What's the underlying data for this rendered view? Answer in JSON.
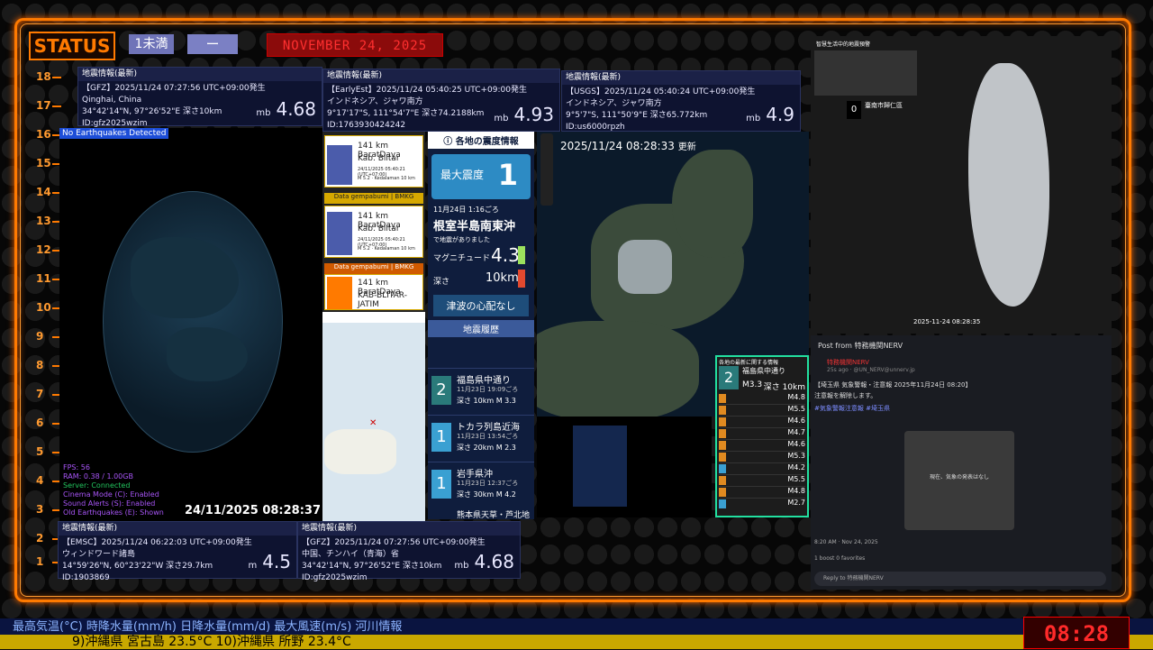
{
  "status": {
    "label": "STATUS",
    "badge1": "1未満",
    "badge2": "ー",
    "date": "NOVEMBER 24, 2025"
  },
  "ruler": [
    "18",
    "17",
    "16",
    "15",
    "14",
    "13",
    "12",
    "11",
    "10",
    "9",
    "8",
    "7",
    "6",
    "5",
    "4",
    "3",
    "2",
    "1"
  ],
  "cards": [
    {
      "hdr": "地震情報(最新)",
      "l1": "【GFZ】2025/11/24  07:27:56  UTC+09:00発生",
      "l2": "Qinghai, China",
      "l3": "34°42'14\"N, 97°26'52\"E  深さ10km",
      "l4": "ID:gfz2025wzim",
      "mb": "mb",
      "mag": "4.68"
    },
    {
      "hdr": "地震情報(最新)",
      "l1": "【EarlyEst】2025/11/24  05:40:25  UTC+09:00発生",
      "l2": "インドネシア、ジャワ南方",
      "l3": "9°17'17\"S, 111°54'7\"E  深さ74.2188km",
      "l4": "ID:1763930424242",
      "mb": "mb",
      "mag": "4.93"
    },
    {
      "hdr": "地震情報(最新)",
      "l1": "【USGS】2025/11/24  05:40:24  UTC+09:00発生",
      "l2": "インドネシア、ジャワ南方",
      "l3": "9°5'7\"S, 111°50'9\"E  深さ65.772km",
      "l4": "ID:us6000rpzh",
      "mb": "mb",
      "mag": "4.9"
    },
    {
      "hdr": "地震情報(最新)",
      "l1": "【EMSC】2025/11/24  06:22:03  UTC+09:00発生",
      "l2": "ウィンドワード諸島",
      "l3": "14°59'26\"N, 60°23'22\"W  深さ29.7km",
      "l4": "ID:1903869",
      "mb": "m",
      "mag": "4.5"
    },
    {
      "hdr": "地震情報(最新)",
      "l1": "【GFZ】2025/11/24  07:27:56  UTC+09:00発生",
      "l2": "中国、チンハイ（青海）省",
      "l3": "34°42'14\"N, 97°26'52\"E  深さ10km",
      "l4": "ID:gfz2025wzim",
      "mb": "mb",
      "mag": "4.68"
    }
  ],
  "globe": {
    "notice": "No Earthquakes Detected",
    "timestamp": "24/11/2025 08:28:37",
    "debug": [
      "FPS: 56",
      "RAM: 0.38 / 1.00GB",
      "Server: Connected",
      "Cinema Mode (C): Enabled",
      "Sound Alerts (S): Enabled",
      "Old Earthquakes (E): Shown"
    ]
  },
  "indo": [
    {
      "head": "Data gempabumi | BMKG",
      "dist": "141 km BaratDaya",
      "place": "Kab. Blitar",
      "date": "24/11/2025 05:40:21 (UTC+07:00)",
      "mag": "M 5.2 · Kedalaman 10 km"
    },
    {
      "head": "Data gempabumi | BMKG",
      "dist": "141 km BaratDaya",
      "place": "Kab. Blitar",
      "date": "24/11/2025 05:40:21 (UTC+07:00)",
      "mag": "M 5.2 · Kedalaman 10 km"
    },
    {
      "head": "Data gempabumi | BMKG",
      "dist": "141 km BaratDaya",
      "place": "KAB-BLITAR-JATIM",
      "date": "",
      "mag": ""
    }
  ],
  "jp": {
    "title": "ⓘ 各地の震度情報",
    "maxlabel": "最大震度",
    "maxval": "1",
    "when": "11月24日 1:16ごろ",
    "place": "根室半島南東沖",
    "sub": "で地震がありました",
    "maglabel": "マグニチュード",
    "mag": "4.3",
    "depthlabel": "深さ",
    "depth": "10km",
    "tsunami": "津波の心配なし",
    "histtitle": "地震履歴",
    "history": [
      {
        "n": "2",
        "t": "福島県中通り",
        "s": "11月23日 19:09ごろ",
        "m": "深さ 10km  M 3.3"
      },
      {
        "n": "1",
        "t": "トカラ列島近海",
        "s": "11月23日 13:54ごろ",
        "m": "深さ 20km  M 2.3"
      },
      {
        "n": "1",
        "t": "岩手県沖",
        "s": "11月23日 12:37ごろ",
        "m": "深さ 30km  M 4.2"
      }
    ],
    "last": "熊本県天草・芦北地方"
  },
  "map": {
    "timestamp": "2025/11/24  08:28:33",
    "upd": "更新"
  },
  "recent": {
    "title": "各地の最新に関する情報",
    "int": "2",
    "place": "福島県中通り",
    "mag": "M3.3",
    "depth": "深さ 10km",
    "list": [
      "M4.8",
      "M5.5",
      "M4.6",
      "M4.7",
      "M4.6",
      "M5.3",
      "M4.2",
      "M5.5",
      "M4.8",
      "M2.7"
    ]
  },
  "tw": {
    "title": "智慧生活中的地震預警",
    "city": "臺南市歸仁區",
    "val": "0",
    "time": "2025-11-24 08:28:35"
  },
  "nerv": {
    "back": "Post from 特務機関NERV",
    "name": "特務機関NERV",
    "handle": "25s ago · @UN_NERV@unnerv.jp",
    "body": "【埼玉県 気象警報・注意報 2025年11月24日 08:20】",
    "body2": "注意報を解除します。",
    "tags": "#気象警報注意報 #埼玉県",
    "mapnote": "現在、気象の発表はなし",
    "footer": "8:20 AM · Nov 24, 2025",
    "boosts": "1 boost  0 favorites",
    "reply": "Reply to 特務機関NERV"
  },
  "ticker": {
    "line1": "最高気温(°C)  時降水量(mm/h)  日降水量(mm/d)  最大風速(m/s)  河川情報",
    "line2": "9)沖縄県 宮古島 23.5°C     10)沖縄県 所野 23.4°C",
    "clock": "08:28"
  },
  "colors": {
    "accent": "#ff7a00",
    "panel": "#0e1330"
  }
}
